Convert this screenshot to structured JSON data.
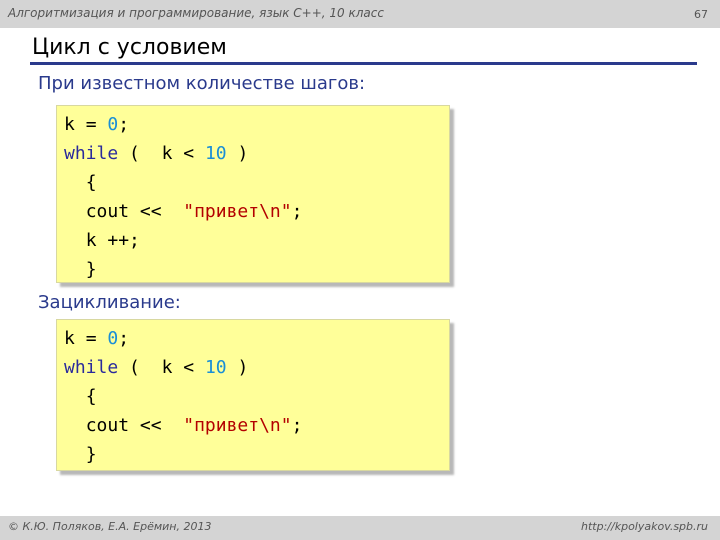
{
  "header": {
    "course": "Алгоритмизация и программирование, язык C++, 10 класс",
    "slide_number": "67"
  },
  "title": "Цикл с условием",
  "sections": [
    {
      "heading": "При известном количестве шагов:",
      "code": {
        "l1": {
          "var": "k",
          "eq": "=",
          "num": "0",
          "semi": ";"
        },
        "l2": {
          "kw": "while",
          "open": "(",
          "var": "k",
          "op": "<",
          "num": "10",
          "close": ")"
        },
        "l3": {
          "brace": "{"
        },
        "l4": {
          "a": "cout <<",
          "str": "\"привет\\n\"",
          "semi": ";"
        },
        "l5": {
          "text": "k ++;"
        },
        "l6": {
          "brace": "}"
        }
      }
    },
    {
      "heading": "Зацикливание:",
      "code": {
        "l1": {
          "var": "k",
          "eq": "=",
          "num": "0",
          "semi": ";"
        },
        "l2": {
          "kw": "while",
          "open": "(",
          "var": "k",
          "op": "<",
          "num": "10",
          "close": ")"
        },
        "l3": {
          "brace": "{"
        },
        "l4": {
          "a": "cout <<",
          "str": "\"привет\\n\"",
          "semi": ";"
        },
        "l5": {
          "brace": "}"
        }
      }
    }
  ],
  "footer": {
    "author": "© К.Ю. Поляков, Е.А. Ерёмин, 2013",
    "site": "http://kpolyakov.spb.ru"
  },
  "colors": {
    "heading": "#2a3a8c",
    "keyword": "#2a2a9c",
    "number": "#1a8fd6",
    "string": "#b30000",
    "code_background": "#ffff99",
    "bar": "#d4d4d4"
  }
}
